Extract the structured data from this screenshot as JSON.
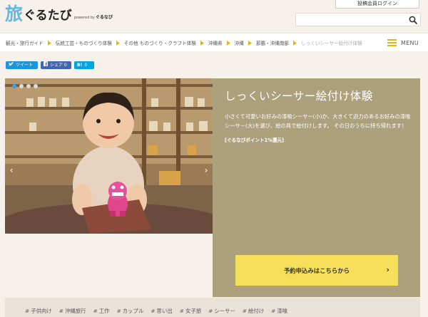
{
  "header": {
    "logo": {
      "kanji": "旅",
      "kana": "ぐるたび",
      "powered_by": "powered by",
      "brand": "ぐるなび"
    },
    "login_label": "投稿会員ログイン",
    "search": {
      "placeholder": ""
    }
  },
  "breadcrumb": {
    "items": [
      "観光・旅行ガイド",
      "伝統工芸・ものづくり体験",
      "その他 ものづくり・クラフト体験",
      "沖縄県",
      "沖縄",
      "那覇・沖縄南部",
      "しっくいシーサー絵付け体験"
    ]
  },
  "menu": {
    "label": "MENU"
  },
  "share": {
    "tweet": "ツイート",
    "facebook": "シェア 0",
    "hatena_icon": "B!",
    "hatena_count": "0"
  },
  "hero": {
    "title": "しっくいシーサー絵付け体験",
    "description": "小さくて可愛いお好みの漆喰シーサー(小)か、大きくて迫力のあるお好みの漆喰シーサー(大)を選び、絵の具で絵付けします。 その日のうちに持ち帰れます！",
    "points": "[ぐるなびポイント1%還元]",
    "cta_label": "予約申込みはこちらから",
    "slide_count": 4,
    "active_slide": 1,
    "prev_symbol": "‹",
    "next_symbol": "›"
  },
  "tags": [
    "子供向け",
    "沖縄旅行",
    "工作",
    "カップル",
    "思い出",
    "女子旅",
    "シーサー",
    "絵付け",
    "漆喰"
  ],
  "colors": {
    "accent_yellow": "#f6e05a",
    "hero_panel": "#ada17d",
    "tweet": "#1b95e0",
    "facebook": "#4267b2",
    "hatena": "#00a4de",
    "menu_icon": "#e6b316"
  }
}
